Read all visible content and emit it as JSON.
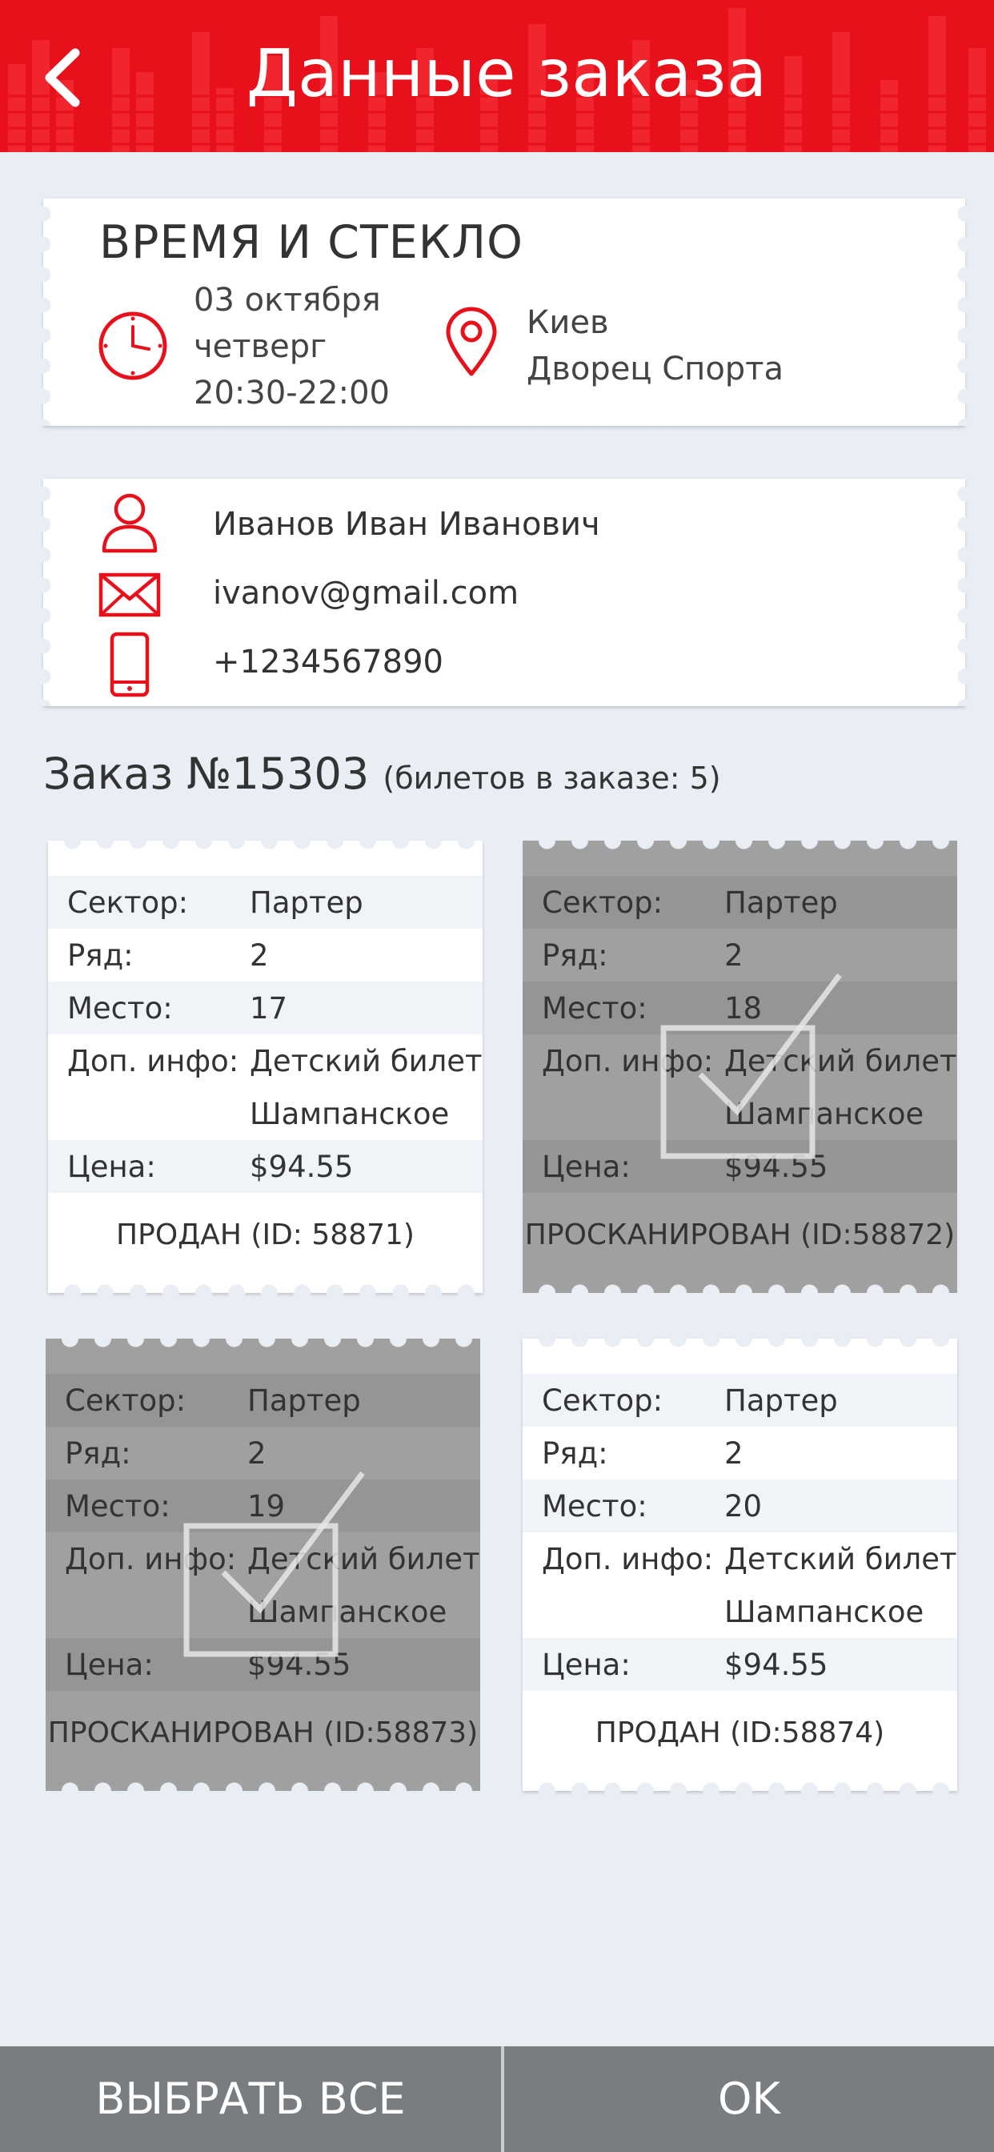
{
  "header": {
    "title": "Данные заказа",
    "back_icon": "chevron-left-icon"
  },
  "event": {
    "name": "ВРЕМЯ И СТЕКЛО",
    "date": "03 октября",
    "weekday": "четверг",
    "time": "20:30-22:00",
    "city": "Киев",
    "venue": "Дворец Спорта"
  },
  "customer": {
    "name": "Иванов Иван Иванович",
    "email": "ivanov@gmail.com",
    "phone": "+1234567890"
  },
  "order": {
    "title": "Заказ №15303",
    "tickets_count_label": "(билетов в заказе: 5)"
  },
  "ticket_labels": {
    "sector": "Сектор:",
    "row": "Ряд:",
    "seat": "Место:",
    "extra": "Доп. инфо:",
    "price": "Цена:"
  },
  "tickets": [
    {
      "sector": "Партер",
      "row": "2",
      "seat": "17",
      "extra1": "Детский билет",
      "extra2": "Шампанское",
      "price": "$94.55",
      "status": "ПРОДАН (ID: 58871)",
      "scanned": false
    },
    {
      "sector": "Партер",
      "row": "2",
      "seat": "18",
      "extra1": "Детский билет",
      "extra2": "Шампанское",
      "price": "$94.55",
      "status": "ПРОСКАНИРОВАН (ID:58872)",
      "scanned": true
    },
    {
      "sector": "Партер",
      "row": "2",
      "seat": "19",
      "extra1": "Детский билет",
      "extra2": "Шампанское",
      "price": "$94.55",
      "status": "ПРОСКАНИРОВАН (ID:58873)",
      "scanned": true
    },
    {
      "sector": "Партер",
      "row": "2",
      "seat": "20",
      "extra1": "Детский билет",
      "extra2": "Шампанское",
      "price": "$94.55",
      "status": "ПРОДАН (ID:58874)",
      "scanned": false
    }
  ],
  "footer": {
    "select_all": "ВЫБРАТЬ ВСЕ",
    "ok": "OK"
  },
  "colors": {
    "accent": "#e8101a",
    "background": "#e9eef5",
    "scanned_ticket": "#a0a0a0",
    "footer": "#7a7d80"
  },
  "icons": [
    "clock-icon",
    "location-pin-icon",
    "user-icon",
    "envelope-icon",
    "phone-icon",
    "checkmark-icon"
  ]
}
